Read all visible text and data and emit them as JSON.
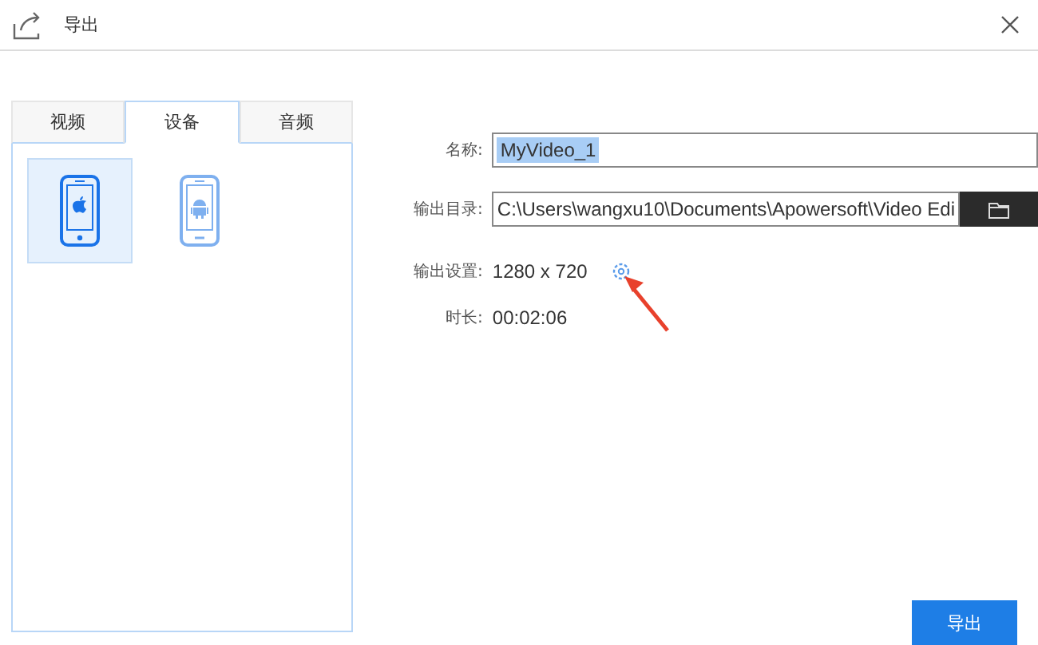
{
  "window": {
    "title": "导出"
  },
  "tabs": [
    {
      "label": "视频",
      "selected": false
    },
    {
      "label": "设备",
      "selected": true
    },
    {
      "label": "音频",
      "selected": false
    }
  ],
  "devices": [
    {
      "kind": "apple",
      "selected": true
    },
    {
      "kind": "android",
      "selected": false
    }
  ],
  "form": {
    "name_label": "名称:",
    "name_value": "MyVideo_1",
    "name_selected": true,
    "dir_label": "输出目录:",
    "dir_value": "C:\\Users\\wangxu10\\Documents\\Apowersoft\\Video Edi",
    "settings_label": "输出设置:",
    "settings_value": "1280 x 720",
    "duration_label": "时长:",
    "duration_value": "00:02:06"
  },
  "export_button": "导出"
}
